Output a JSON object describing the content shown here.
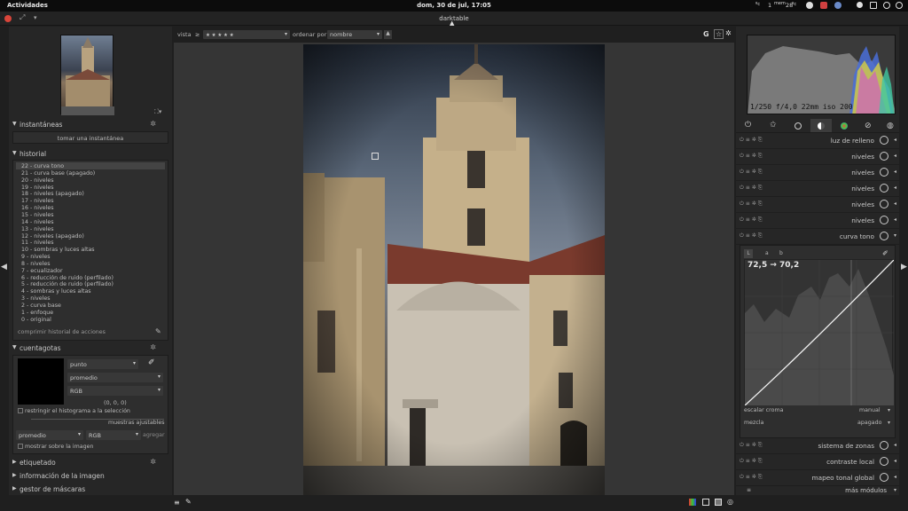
{
  "topbar": {
    "activities": "Actividades",
    "clock": "dom, 30 de jul, 17:05",
    "tray_temp1": "1",
    "tray_temp1_unit": "ºc",
    "tray_mem": "mem",
    "tray_temp2": "28",
    "tray_temp2_unit": "ºc"
  },
  "window": {
    "title": "darktable"
  },
  "left": {
    "snapshots": {
      "title": "instantáneas",
      "button": "tomar una instantánea"
    },
    "history": {
      "title": "historial",
      "items": [
        "22 - curva tono",
        "21 - curva base (apagado)",
        "20 - niveles",
        "19 - niveles",
        "18 - niveles (apagado)",
        "17 - niveles",
        "16 - niveles",
        "15 - niveles",
        "14 - niveles",
        "13 - niveles",
        "12 - niveles (apagado)",
        "11 - niveles",
        "10 - sombras y luces altas",
        "9 - niveles",
        "8 - niveles",
        "7 - ecualizador",
        "6 - reducción de ruido (perfilado)",
        "5 - reducción de ruido (perfilado)",
        "4 - sombras y luces altas",
        "3 - niveles",
        "2 - curva base",
        "1 - enfoque",
        "0 - original"
      ],
      "compress": "comprimir historial de acciones"
    },
    "picker": {
      "title": "cuentagotas",
      "mode": "punto",
      "stat": "promedio",
      "colorspace": "RGB",
      "value": "(0, 0, 0)",
      "restrict": "restringir el histograma a la selección",
      "samples": "muestras ajustables",
      "sample_stat": "promedio",
      "sample_space": "RGB",
      "add": "agregar",
      "show_on_image": "mostrar sobre la imagen"
    },
    "tags": "etiquetado",
    "image_info": "información de la imagen",
    "mask_manager": "gestor de máscaras"
  },
  "center": {
    "view_label": "vista",
    "view_op": "≥",
    "view_stars": "★ ★ ★ ★ ★",
    "sort_label": "ordenar por",
    "sort_value": "nombre",
    "top_right_g": "G"
  },
  "right": {
    "exif": "1/250 f/4,0 22mm iso 200",
    "modules": [
      {
        "name": "luz de relleno",
        "icon": "fill-light-icon"
      },
      {
        "name": "niveles",
        "icon": "levels-icon"
      },
      {
        "name": "niveles",
        "icon": "levels-icon"
      },
      {
        "name": "niveles",
        "icon": "levels-icon"
      },
      {
        "name": "niveles",
        "icon": "levels-icon"
      },
      {
        "name": "niveles",
        "icon": "levels-icon"
      },
      {
        "name": "curva tono",
        "icon": "tone-curve-icon"
      }
    ],
    "curve": {
      "tabs": [
        "L",
        "a",
        "b"
      ],
      "readout": "72,5 → 70,2",
      "scale_label": "escalar croma",
      "scale_value": "manual",
      "blend_label": "mezcla",
      "blend_value": "apagado"
    },
    "lower_modules": [
      {
        "name": "sistema de zonas",
        "icon": "zone-system-icon"
      },
      {
        "name": "contraste local",
        "icon": "local-contrast-icon"
      },
      {
        "name": "mapeo tonal global",
        "icon": "global-tonemap-icon"
      }
    ],
    "more_modules": "más módulos"
  },
  "colors": {
    "accent": "#cfcfcf",
    "panel": "#262626",
    "background": "#1f1f1f"
  }
}
